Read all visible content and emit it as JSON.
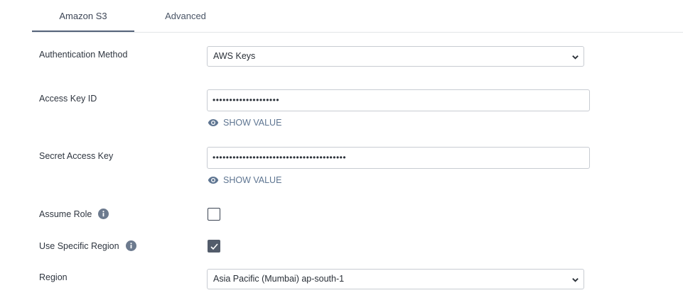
{
  "tabs": [
    {
      "label": "Amazon S3",
      "active": true
    },
    {
      "label": "Advanced",
      "active": false
    }
  ],
  "form": {
    "auth_method": {
      "label": "Authentication Method",
      "value": "AWS Keys"
    },
    "access_key": {
      "label": "Access Key ID",
      "value": "••••••••••••••••••••",
      "show_label": "SHOW VALUE"
    },
    "secret_key": {
      "label": "Secret Access Key",
      "value": "••••••••••••••••••••••••••••••••••••••••",
      "show_label": "SHOW VALUE"
    },
    "assume_role": {
      "label": "Assume Role",
      "checked": false
    },
    "specific_region": {
      "label": "Use Specific Region",
      "checked": true
    },
    "region": {
      "label": "Region",
      "value": "Asia Pacific (Mumbai) ap-south-1"
    }
  },
  "colors": {
    "accent": "#55637a",
    "link": "#5e7591",
    "checkbox_checked": "#535c6b"
  }
}
